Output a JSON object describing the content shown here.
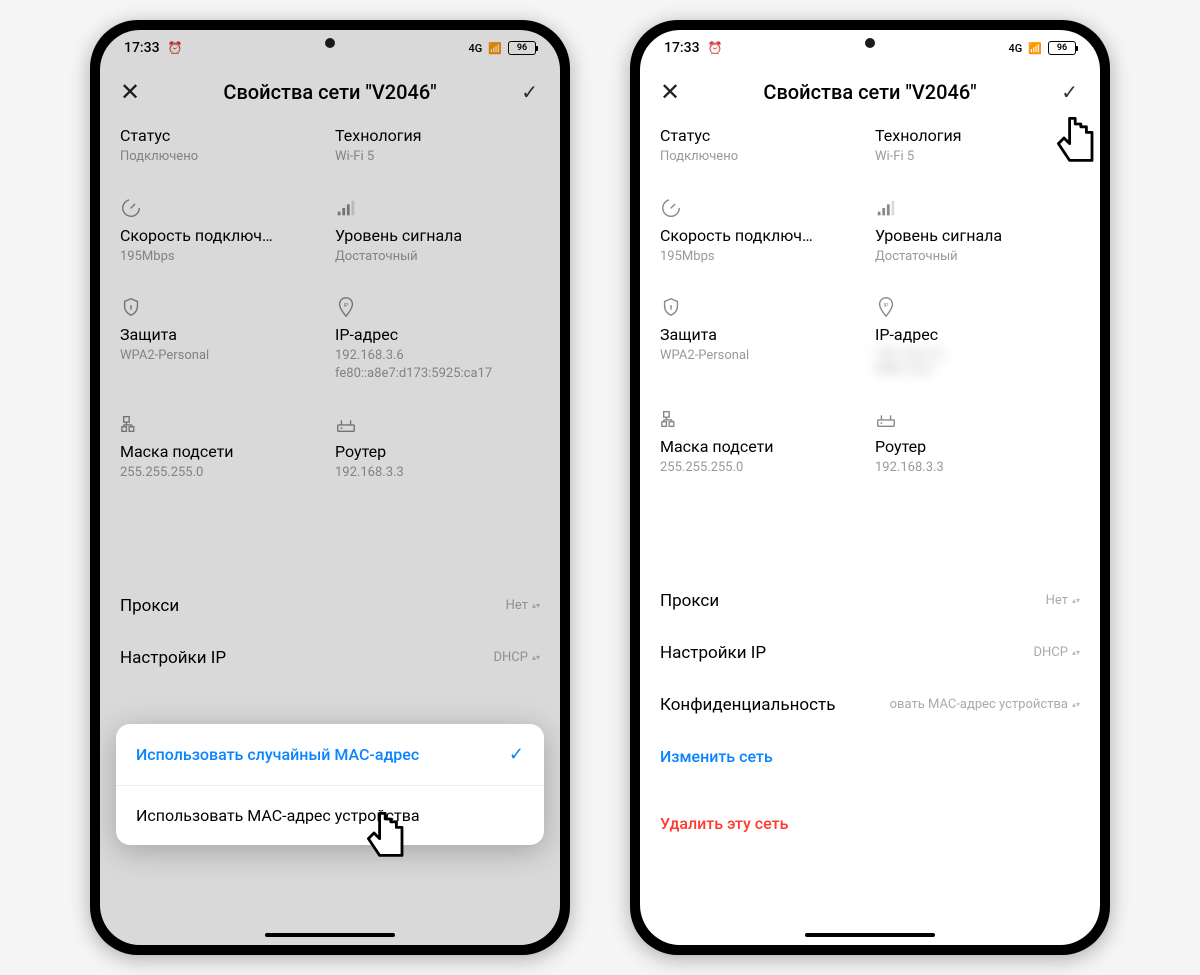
{
  "statusbar": {
    "time": "17:33",
    "net": "4G",
    "battery": "96"
  },
  "header": {
    "title": "Свойства сети \"V2046\""
  },
  "cells": {
    "status": {
      "label": "Статус",
      "value": "Подключено"
    },
    "tech": {
      "label": "Технология",
      "value": "Wi-Fi 5"
    },
    "speed": {
      "label": "Скорость подключ…",
      "value": "195Mbps"
    },
    "signal": {
      "label": "Уровень сигнала",
      "value": "Достаточный"
    },
    "security": {
      "label": "Защита",
      "value": "WPA2-Personal"
    },
    "ip": {
      "label": "IP-адрес",
      "value1": "192.168.3.6",
      "value2": "fe80::a8e7:d173:5925:ca17"
    },
    "mask": {
      "label": "Маска подсети",
      "value": "255.255.255.0"
    },
    "router": {
      "label": "Роутер",
      "value": "192.168.3.3"
    }
  },
  "rows": {
    "proxy": {
      "label": "Прокси",
      "value": "Нет"
    },
    "ipset": {
      "label": "Настройки IP",
      "value": "DHCP"
    },
    "privacy": {
      "label": "Конфиденциальность",
      "value": "овать MAC-адрес устройства"
    }
  },
  "links": {
    "modify": "Изменить сеть",
    "delete": "Удалить эту сеть"
  },
  "popup": {
    "opt1": "Использовать случайный МАС-адрес",
    "opt2": "Использовать МАС-адрес устройства"
  }
}
